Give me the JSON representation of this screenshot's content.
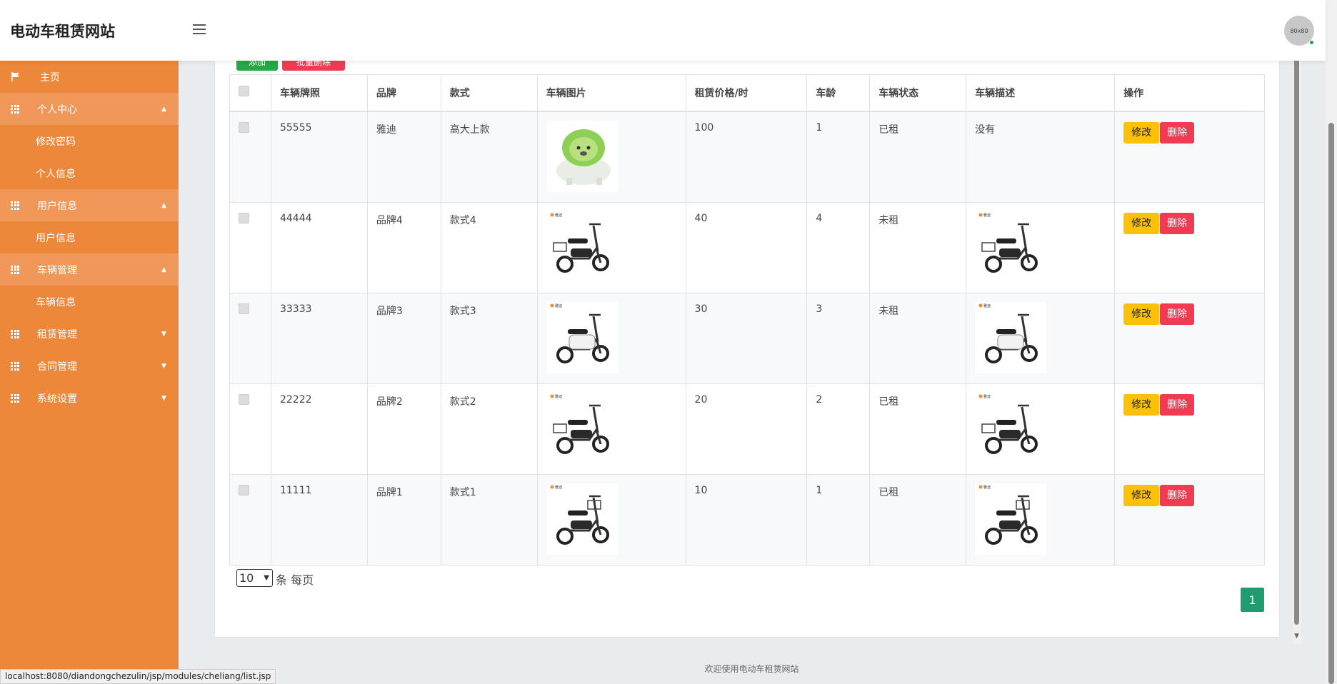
{
  "header": {
    "brand": "电动车租赁网站",
    "avatar_text": "80x80"
  },
  "sidebar": {
    "home": "主页",
    "groups": [
      {
        "label": "个人中心",
        "open": true,
        "items": [
          "修改密码",
          "个人信息"
        ]
      },
      {
        "label": "用户信息",
        "open": true,
        "items": [
          "用户信息"
        ]
      },
      {
        "label": "车辆管理",
        "open": true,
        "items": [
          "车辆信息"
        ]
      },
      {
        "label": "租赁管理",
        "open": false,
        "items": []
      },
      {
        "label": "合同管理",
        "open": false,
        "items": []
      },
      {
        "label": "系统设置",
        "open": false,
        "items": []
      }
    ]
  },
  "toolbar": {
    "add_label": "添加",
    "batch_delete_label": "批量删除"
  },
  "table": {
    "headers": [
      "车辆牌照",
      "品牌",
      "款式",
      "车辆图片",
      "租赁价格/时",
      "车龄",
      "车辆状态",
      "车辆描述",
      "操作"
    ],
    "rows": [
      {
        "plate": "55555",
        "brand": "雅迪",
        "style": "高大上款",
        "image": "cabbage-dog-image",
        "price": "100",
        "age": "1",
        "status": "已租",
        "desc_text": "没有",
        "desc_image": ""
      },
      {
        "plate": "44444",
        "brand": "品牌4",
        "style": "款式4",
        "image": "scooter-black-basket-image",
        "price": "40",
        "age": "4",
        "status": "未租",
        "desc_text": "",
        "desc_image": "scooter-black-basket-image"
      },
      {
        "plate": "33333",
        "brand": "品牌3",
        "style": "款式3",
        "image": "scooter-white-image",
        "price": "30",
        "age": "3",
        "status": "未租",
        "desc_text": "",
        "desc_image": "scooter-white-image"
      },
      {
        "plate": "22222",
        "brand": "品牌2",
        "style": "款式2",
        "image": "scooter-black-basket-image",
        "price": "20",
        "age": "2",
        "status": "已租",
        "desc_text": "",
        "desc_image": "scooter-black-basket-image"
      },
      {
        "plate": "11111",
        "brand": "品牌1",
        "style": "款式1",
        "image": "scooter-small-image",
        "price": "10",
        "age": "1",
        "status": "已租",
        "desc_text": "",
        "desc_image": "scooter-small-image"
      }
    ],
    "edit_label": "修改",
    "delete_label": "删除"
  },
  "pagination": {
    "page_size": "10",
    "page_size_suffix": "条 每页",
    "current_page": "1"
  },
  "footer": {
    "text": "欢迎使用电动车租赁网站"
  },
  "statusbar": {
    "url": "localhost:8080/diandongchezulin/jsp/modules/cheliang/list.jsp"
  },
  "colors": {
    "sidebar": "#ed873a",
    "sidebar_open": "#f0975a",
    "edit": "#ffc107",
    "delete": "#f03c52",
    "add": "#28a745",
    "page": "#1f9d70"
  }
}
